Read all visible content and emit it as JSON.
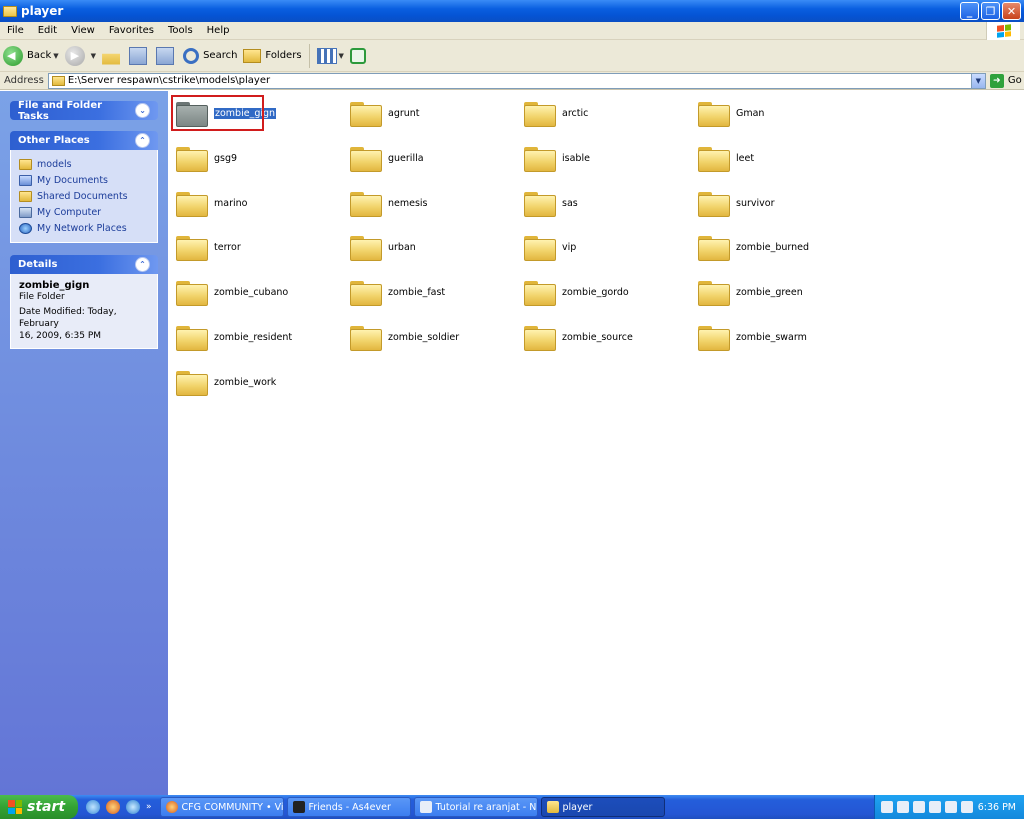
{
  "window": {
    "title": "player"
  },
  "menu": [
    "File",
    "Edit",
    "View",
    "Favorites",
    "Tools",
    "Help"
  ],
  "toolbar": {
    "back_label": "Back",
    "search_label": "Search",
    "folders_label": "Folders"
  },
  "address": {
    "label": "Address",
    "value": "E:\\Server respawn\\cstrike\\models\\player",
    "go_label": "Go"
  },
  "left_pane": {
    "tasks_title": "File and Folder Tasks",
    "other_title": "Other Places",
    "other_places": [
      "models",
      "My Documents",
      "Shared Documents",
      "My Computer",
      "My Network Places"
    ],
    "details_title": "Details",
    "details_name": "zombie_gign",
    "details_type": "File Folder",
    "details_modified_1": "Date Modified: Today, February",
    "details_modified_2": "16, 2009, 6:35 PM"
  },
  "folders": [
    "zombie_gign",
    "agrunt",
    "arctic",
    "Gman",
    "gsg9",
    "guerilla",
    "isable",
    "leet",
    "marino",
    "nemesis",
    "sas",
    "survivor",
    "terror",
    "urban",
    "vip",
    "zombie_burned",
    "zombie_cubano",
    "zombie_fast",
    "zombie_gordo",
    "zombie_green",
    "zombie_resident",
    "zombie_soldier",
    "zombie_source",
    "zombie_swarm",
    "zombie_work"
  ],
  "selected_folder": "zombie_gign",
  "taskbar": {
    "start_label": "start",
    "tasks": [
      "CFG COMMUNITY • Vi...",
      "Friends - As4ever",
      "Tutorial re aranjat - N...",
      "player"
    ],
    "active_task": "player",
    "clock": "6:36 PM"
  }
}
